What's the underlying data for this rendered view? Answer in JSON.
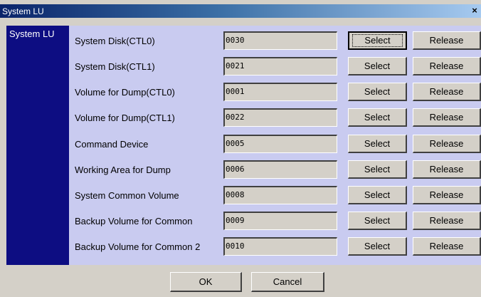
{
  "window": {
    "title": "System LU",
    "close_glyph": "×"
  },
  "sidebar": {
    "items": [
      {
        "label": "System LU"
      }
    ]
  },
  "rows": [
    {
      "label": "System Disk(CTL0)",
      "value": "0030"
    },
    {
      "label": "System Disk(CTL1)",
      "value": "0021"
    },
    {
      "label": "Volume for Dump(CTL0)",
      "value": "0001"
    },
    {
      "label": "Volume for Dump(CTL1)",
      "value": "0022"
    },
    {
      "label": "Command Device",
      "value": "0005"
    },
    {
      "label": "Working Area for Dump",
      "value": "0006"
    },
    {
      "label": "System Common Volume",
      "value": "0008"
    },
    {
      "label": "Backup Volume for Common",
      "value": "0009"
    },
    {
      "label": "Backup Volume for Common 2",
      "value": "0010"
    }
  ],
  "buttons": {
    "select_label": "Select",
    "release_label": "Release"
  },
  "footer": {
    "ok_label": "OK",
    "cancel_label": "Cancel"
  },
  "colors": {
    "titlebar_start": "#0a246a",
    "titlebar_end": "#a6caf0",
    "sidebar_bg": "#0d0d82",
    "panel_bg": "#c9cbf0",
    "dialog_bg": "#d4d0c8"
  }
}
